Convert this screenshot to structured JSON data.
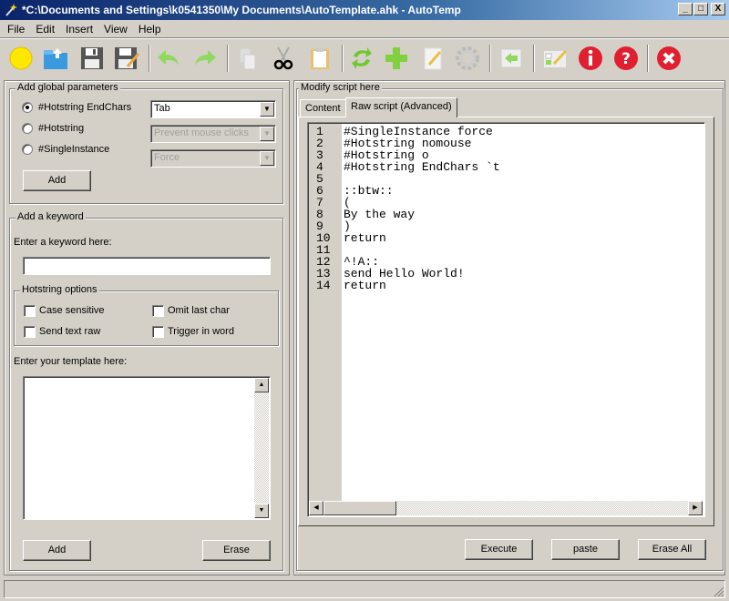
{
  "window": {
    "title": "*C:\\Documents and Settings\\k0541350\\My Documents\\AutoTemplate.ahk - AutoTemp",
    "controls": {
      "minimize": "_",
      "maximize": "□",
      "close": "X"
    }
  },
  "menu": [
    {
      "label": "File"
    },
    {
      "label": "Edit"
    },
    {
      "label": "Insert"
    },
    {
      "label": "View"
    },
    {
      "label": "Help"
    }
  ],
  "toolbar": [
    {
      "icon": "new-icon",
      "tooltip": "New"
    },
    {
      "icon": "open-icon",
      "tooltip": "Open"
    },
    {
      "icon": "save-icon",
      "tooltip": "Save"
    },
    {
      "icon": "save-as-icon",
      "tooltip": "Save As"
    },
    {
      "icon": "undo-icon",
      "tooltip": "Undo"
    },
    {
      "icon": "redo-icon",
      "tooltip": "Redo"
    },
    {
      "icon": "copy-icon",
      "tooltip": "Copy"
    },
    {
      "icon": "cut-icon",
      "tooltip": "Cut"
    },
    {
      "icon": "paste-icon",
      "tooltip": "Paste"
    },
    {
      "icon": "refresh-icon",
      "tooltip": "Refresh"
    },
    {
      "icon": "add-icon",
      "tooltip": "Add"
    },
    {
      "icon": "edit-icon",
      "tooltip": "Edit"
    },
    {
      "icon": "settings-icon",
      "tooltip": "Settings"
    },
    {
      "icon": "insert-icon",
      "tooltip": "Insert"
    },
    {
      "icon": "checklist-icon",
      "tooltip": "Options"
    },
    {
      "icon": "info-icon",
      "tooltip": "Info"
    },
    {
      "icon": "help-icon",
      "tooltip": "Help"
    },
    {
      "icon": "exit-icon",
      "tooltip": "Exit"
    }
  ],
  "global_params": {
    "title": "Add global parameters",
    "options": [
      {
        "label": "#Hotstring EndChars",
        "checked": true,
        "combo_value": "Tab",
        "combo_enabled": true
      },
      {
        "label": "#Hotstring",
        "checked": false,
        "combo_value": "Prevent mouse clicks",
        "combo_enabled": false
      },
      {
        "label": "#SingleInstance",
        "checked": false,
        "combo_value": "Force",
        "combo_enabled": false
      }
    ],
    "add_label": "Add"
  },
  "keyword": {
    "title": "Add a keyword",
    "keyword_label": "Enter a keyword here:",
    "keyword_value": "",
    "hotstring_options": {
      "title": "Hotstring options",
      "items": [
        {
          "label": "Case sensitive",
          "checked": false
        },
        {
          "label": "Omit last char",
          "checked": false
        },
        {
          "label": "Send text raw",
          "checked": false
        },
        {
          "label": "Trigger in word",
          "checked": false
        }
      ]
    },
    "template_label": "Enter your template here:",
    "template_value": "",
    "add_label": "Add",
    "erase_label": "Erase"
  },
  "script": {
    "title": "Modify script here",
    "tabs": [
      {
        "label": "Content",
        "active": false
      },
      {
        "label": "Raw script (Advanced)",
        "active": true
      }
    ],
    "lines": [
      "#SingleInstance force",
      "#Hotstring nomouse",
      "#Hotstring o",
      "#Hotstring EndChars `t",
      "",
      "::btw::",
      "(",
      "By the way",
      ")",
      "return",
      "",
      "^!A::",
      "send Hello World!",
      "return"
    ],
    "buttons": {
      "execute": "Execute",
      "paste": "paste",
      "erase_all": "Erase All"
    }
  },
  "statusbar": {
    "text": ""
  }
}
